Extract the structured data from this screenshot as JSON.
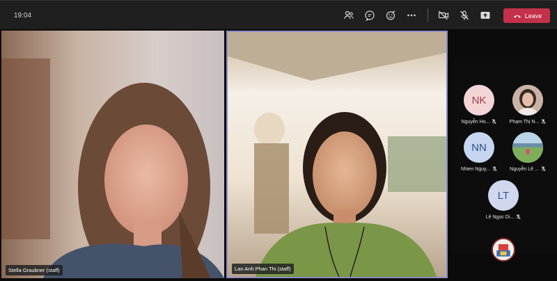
{
  "header": {
    "clock": "19:04",
    "leave_label": "Leave"
  },
  "toolbar": {
    "icons": [
      "people-icon",
      "chat-icon",
      "reactions-icon",
      "more-icon",
      "camera-off-icon",
      "mic-off-icon",
      "share-icon"
    ]
  },
  "videos": [
    {
      "name": "Stella Graubner (staff)"
    },
    {
      "name": "Lan Anh Phan Thi (staff)"
    }
  ],
  "participants": [
    {
      "initials": "NK",
      "name": "Nguyễn Ho...",
      "avatar_bg": "#f4d5d7",
      "initial_color": "#9b3f4a"
    },
    {
      "initials": "",
      "name": "Phạm Thị N...",
      "avatar_bg": "#d8c4bc",
      "initial_color": "#ffffff"
    },
    {
      "initials": "NN",
      "name": "Nhien Nguy...",
      "avatar_bg": "#c6d6f0",
      "initial_color": "#2f4f86"
    },
    {
      "initials": "",
      "name": "Nguyễn Lê ...",
      "avatar_bg": "#a6c79b",
      "initial_color": "#ffffff"
    },
    {
      "initials": "LT",
      "name": "Lê Ngọc Di...",
      "avatar_bg": "#cfd8ef",
      "initial_color": "#34538f"
    }
  ],
  "colors": {
    "leave": "#c4314b",
    "active_speaker_border": "#8b8cc7",
    "topbar": "#1f1f1f"
  }
}
